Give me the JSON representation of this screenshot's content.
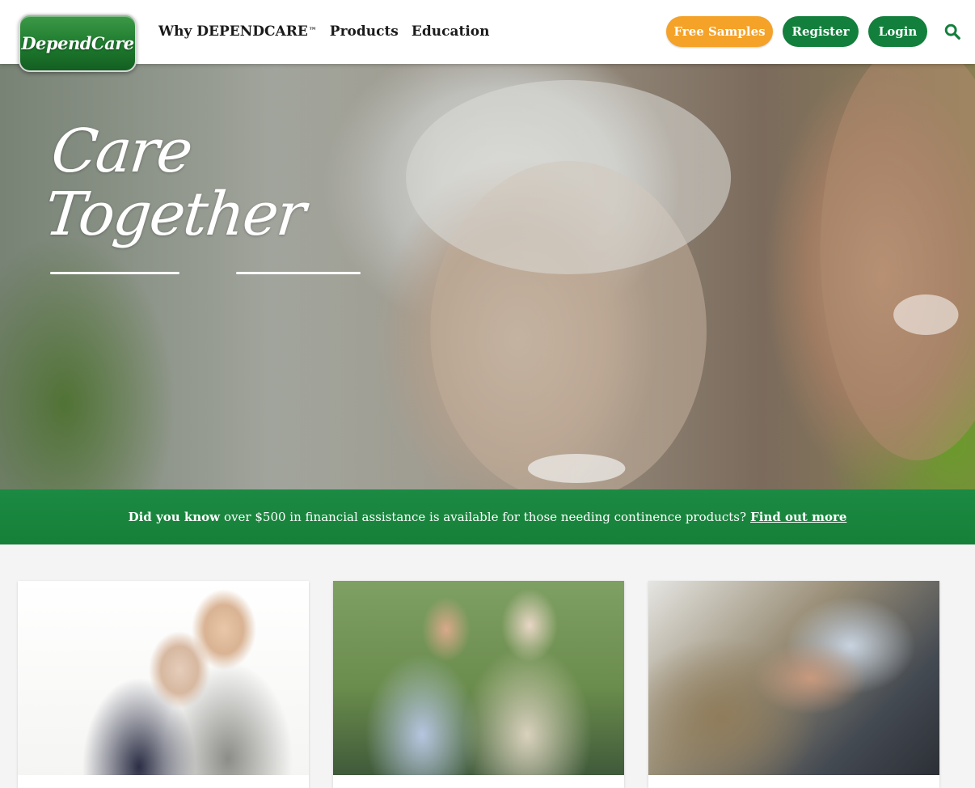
{
  "brand": {
    "logo_text": "DependCare",
    "colors": {
      "primary_green": "#137f3c",
      "accent_orange": "#f5a228",
      "banner_green": "#1c8a43"
    }
  },
  "nav": {
    "items": [
      {
        "label": "Why DEPENDCARE",
        "superscript": "™"
      },
      {
        "label": "Products"
      },
      {
        "label": "Education"
      }
    ]
  },
  "header_actions": {
    "free_samples_label": "Free Samples",
    "register_label": "Register",
    "login_label": "Login",
    "search_icon": "search-icon"
  },
  "hero": {
    "title": "Care Together"
  },
  "banner": {
    "bold_text": "Did you know",
    "text": "over $500 in financial assistance is available for those needing continence products?",
    "link_text": "Find out more"
  },
  "cards": [
    {
      "image_name": "card-image-caregiver-hug"
    },
    {
      "image_name": "card-image-caregiver-park-bench"
    },
    {
      "image_name": "card-image-holding-hands"
    }
  ]
}
